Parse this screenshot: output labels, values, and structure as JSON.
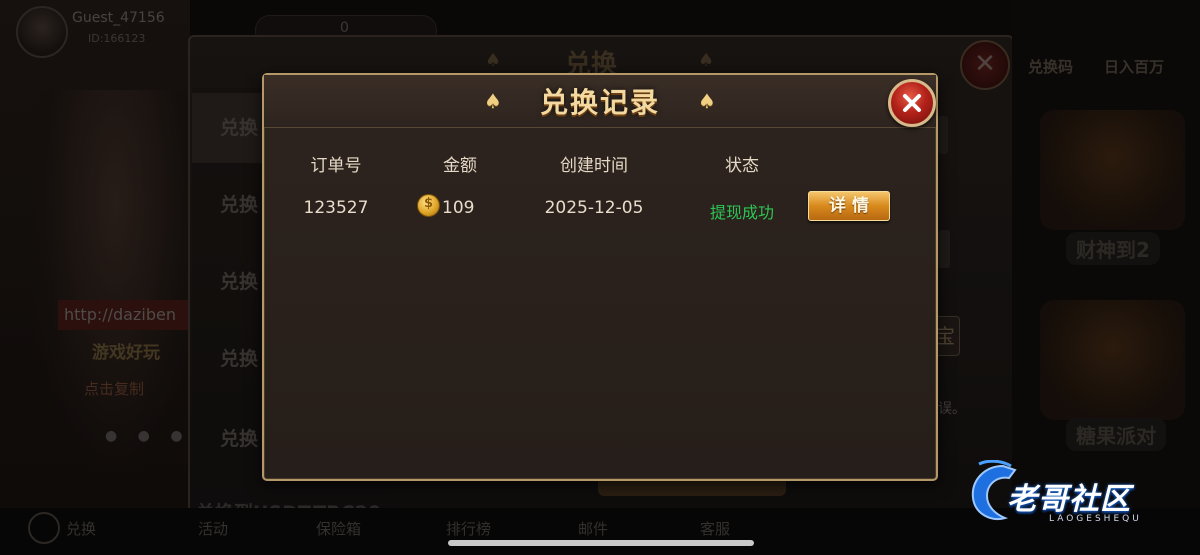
{
  "background": {
    "player_name": "Guest_47156",
    "player_id": "ID:166123",
    "coins": "0",
    "url_banner": "http://daziben",
    "promo_line1": "游戏好玩",
    "promo_line2": "点击复制",
    "dots": "● ● ● ● ●",
    "exchange_title": "兑换",
    "exchange_tabs": [
      "兑换",
      "兑换",
      "兑换",
      "兑换",
      "兑换"
    ],
    "exchange_bao": "宝",
    "exchange_err": "误。",
    "exchange_usdt": "兑换到USDT-TRC20",
    "right_top_left": "兑换码",
    "right_top_right": "日入百万",
    "right_games": [
      "财神到2",
      "糖果派对"
    ],
    "bottom_nav": [
      "兑换",
      "活动",
      "保险箱",
      "排行榜",
      "邮件",
      "客服"
    ]
  },
  "dialog": {
    "title": "兑换记录",
    "close_icon": "close-x-icon",
    "columns": [
      "订单号",
      "金额",
      "创建时间",
      "状态"
    ],
    "rows": [
      {
        "order_no": "123527",
        "amount": "109",
        "created": "2025-12-05",
        "status": "提现成功",
        "detail_label": "详情"
      }
    ],
    "colors": {
      "border": "#b49868",
      "title": "#f3d9a0",
      "status_ok": "#2ec455",
      "detail_button": "#d8891c",
      "close_button": "#b3221a"
    }
  },
  "watermark": {
    "text": "老哥社区",
    "sub": "LAOGESHEQU"
  }
}
